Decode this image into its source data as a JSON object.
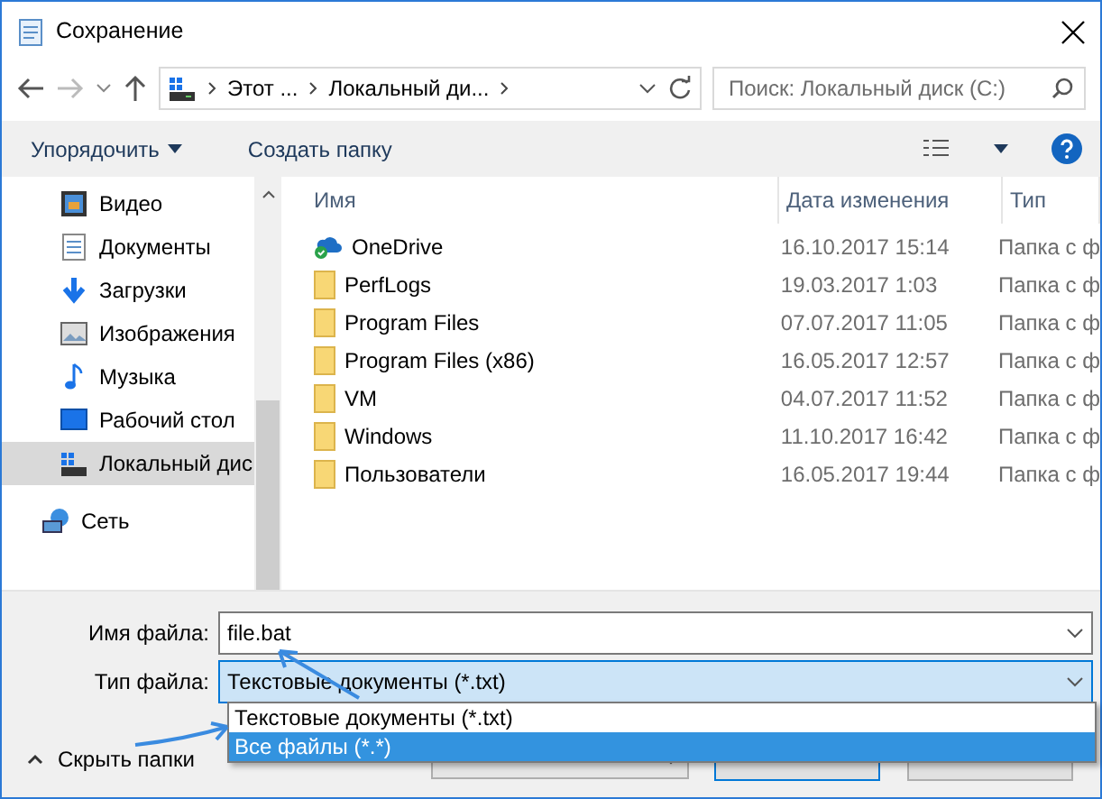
{
  "window": {
    "title": "Сохранение"
  },
  "breadcrumb": [
    "Этот ...",
    "Локальный ди..."
  ],
  "search": {
    "placeholder": "Поиск: Локальный диск (C:)"
  },
  "toolbar": [
    {
      "label": "Упорядочить",
      "dropdown": true
    },
    {
      "label": "Создать папку",
      "dropdown": false
    }
  ],
  "sidebar": {
    "items": [
      {
        "label": "Видео",
        "kind": "video",
        "selected": false
      },
      {
        "label": "Документы",
        "kind": "docs",
        "selected": false
      },
      {
        "label": "Загрузки",
        "kind": "download",
        "selected": false
      },
      {
        "label": "Изображения",
        "kind": "images",
        "selected": false
      },
      {
        "label": "Музыка",
        "kind": "music",
        "selected": false
      },
      {
        "label": "Рабочий стол",
        "kind": "desktop",
        "selected": false
      },
      {
        "label": "Локальный дис",
        "kind": "drive",
        "selected": true
      },
      {
        "label": "Сеть",
        "kind": "network",
        "selected": false
      }
    ]
  },
  "table": {
    "columns": [
      "Имя",
      "Дата изменения",
      "Тип"
    ],
    "rows": [
      {
        "name": "OneDrive",
        "date": "16.10.2017 15:14",
        "type": "Папка с ф",
        "kind": "cloud"
      },
      {
        "name": "PerfLogs",
        "date": "19.03.2017 1:03",
        "type": "Папка с ф",
        "kind": "folder"
      },
      {
        "name": "Program Files",
        "date": "07.07.2017 11:05",
        "type": "Папка с ф",
        "kind": "folder"
      },
      {
        "name": "Program Files (x86)",
        "date": "16.05.2017 12:57",
        "type": "Папка с ф",
        "kind": "folder"
      },
      {
        "name": "VM",
        "date": "04.07.2017 11:52",
        "type": "Папка с ф",
        "kind": "folder"
      },
      {
        "name": "Windows",
        "date": "11.10.2017 16:42",
        "type": "Папка с ф",
        "kind": "folder"
      },
      {
        "name": "Пользователи",
        "date": "16.05.2017 19:44",
        "type": "Папка с ф",
        "kind": "folder"
      }
    ]
  },
  "form": {
    "filename_label": "Имя файла:",
    "filename": "file.bat",
    "type_label": "Тип файла:",
    "type": "Текстовые документы (*.txt)",
    "options": [
      {
        "label": "Текстовые документы (*.txt)",
        "selected": false
      },
      {
        "label": "Все файлы  (*.*)",
        "selected": true
      }
    ],
    "hide_folders": "Скрыть папки"
  }
}
